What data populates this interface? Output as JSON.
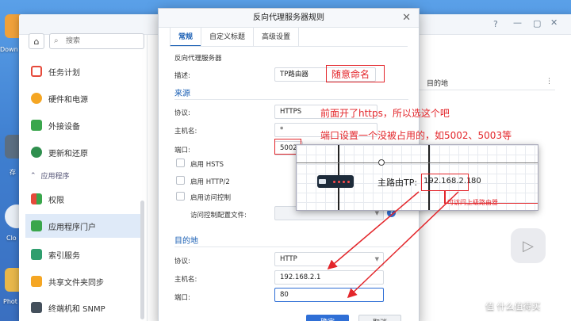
{
  "desktop": {
    "icon_labels": [
      "Down",
      "存",
      "Clo",
      "Phot"
    ]
  },
  "control_panel": {
    "search_placeholder": "搜索",
    "nav_items": [
      {
        "label": "任务计划",
        "icon": "calendar-icon",
        "color": "#e64a3b"
      },
      {
        "label": "硬件和电源",
        "icon": "lightbulb-icon",
        "color": "#f5a623"
      },
      {
        "label": "外接设备",
        "icon": "upload-icon",
        "color": "#3aa64c"
      },
      {
        "label": "更新和还原",
        "icon": "refresh-icon",
        "color": "#2f8f4e"
      },
      {
        "label": "权限",
        "icon": "grid-icon",
        "color": "#e64a3b"
      },
      {
        "label": "应用程序门户",
        "icon": "portal-icon",
        "color": "#3aa64c"
      },
      {
        "label": "索引服务",
        "icon": "search-index-icon",
        "color": "#2f9e6e"
      },
      {
        "label": "共享文件夹同步",
        "icon": "sync-folder-icon",
        "color": "#8a6bd1"
      },
      {
        "label": "终端机和 SNMP",
        "icon": "terminal-icon",
        "color": "#44505c"
      }
    ],
    "section_label": "应用程序",
    "right_header": "目的地",
    "right_dots": "⋮"
  },
  "dialog": {
    "title": "反向代理服务器规则",
    "tabs": [
      "常规",
      "自定义标题",
      "高级设置"
    ],
    "active_tab": 0,
    "intro_label": "反向代理服务器",
    "description_label": "描述:",
    "description_value": "TP路由器",
    "source": {
      "heading": "来源",
      "protocol_label": "协议:",
      "protocol_value": "HTTPS",
      "hostname_label": "主机名:",
      "hostname_value": "*",
      "port_label": "端口:",
      "port_value": "5002",
      "options": [
        "启用 HSTS",
        "启用 HTTP/2",
        "启用访问控制"
      ],
      "acl_label": "访问控制配置文件:"
    },
    "destination": {
      "heading": "目的地",
      "protocol_label": "协议:",
      "protocol_value": "HTTP",
      "hostname_label": "主机名:",
      "hostname_value": "192.168.2.1",
      "port_label": "端口:",
      "port_value": "80"
    },
    "ok_label": "确定",
    "cancel_label": "取消"
  },
  "annotations": {
    "name_note": "随意命名",
    "https_note": "前面开了https，所以选这个吧",
    "port_note": "端口设置一个没被占用的，如5002、5003等"
  },
  "inset": {
    "router_label": "主路由TP:",
    "router_ip": "192.168.2.1",
    "router_ip_suffix": "80",
    "upstream_note": "可访问上级路由器"
  },
  "watermark": "值 什么值得买",
  "colors": {
    "accent": "#1a5fb4",
    "annotation_red": "#e3262b",
    "primary_button": "#2f6fd6"
  }
}
